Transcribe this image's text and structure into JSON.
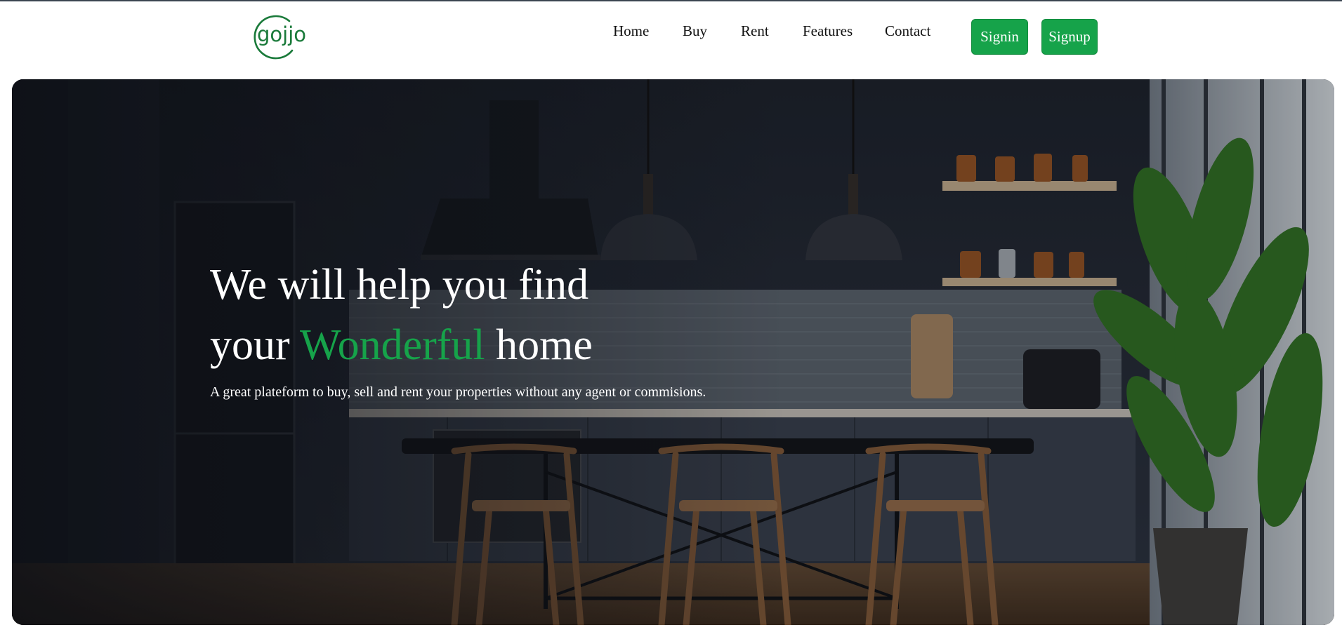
{
  "brand": {
    "name": "gojjo",
    "color": "#1a7a3a"
  },
  "nav": {
    "items": [
      {
        "label": "Home"
      },
      {
        "label": "Buy"
      },
      {
        "label": "Rent"
      },
      {
        "label": "Features"
      },
      {
        "label": "Contact"
      }
    ],
    "signin_label": "Signin",
    "signup_label": "Signup"
  },
  "hero": {
    "headline_line1": "We will help you find",
    "headline_prefix": "your",
    "headline_accent": "Wonderful",
    "headline_suffix": "home",
    "subtitle": "A great plateform to buy, sell and rent your properties without any agent or commisions.",
    "background_image": "dark kitchen interior with pendant lamps, shelves, dining table with wooden chairs and plants"
  },
  "colors": {
    "accent": "#16a34a",
    "text_dark": "#111111",
    "hero_text": "#ffffff"
  }
}
